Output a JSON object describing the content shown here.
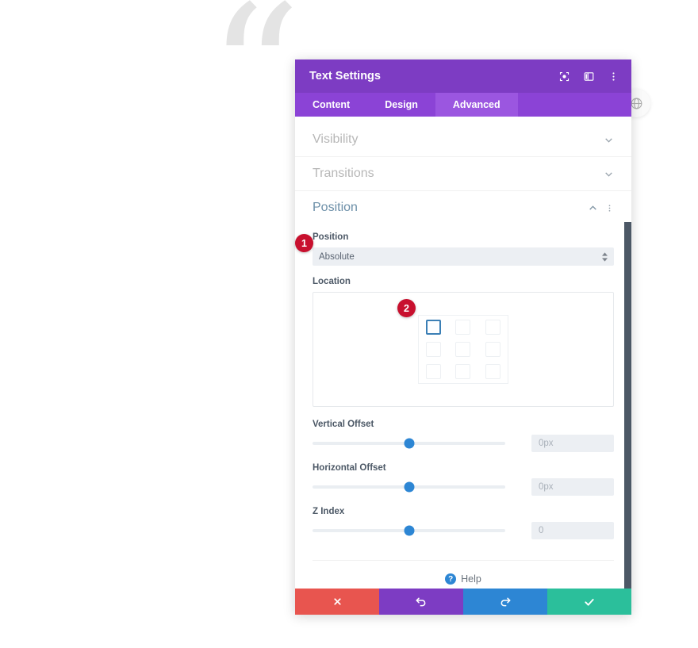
{
  "background": {
    "quote_decoration": "“",
    "side_circle_icon": "globe-icon"
  },
  "modal": {
    "title": "Text Settings",
    "title_icons": [
      {
        "name": "target-icon",
        "label": "Focus"
      },
      {
        "name": "layout-panel-icon",
        "label": "Layout"
      },
      {
        "name": "kebab-menu-icon",
        "label": "More options"
      }
    ],
    "tabs": [
      {
        "label": "Content",
        "active": false
      },
      {
        "label": "Design",
        "active": false
      },
      {
        "label": "Advanced",
        "active": true
      }
    ],
    "sections": [
      {
        "label": "Visibility",
        "open": false,
        "chevron": "chevron-down-icon"
      },
      {
        "label": "Transitions",
        "open": false,
        "chevron": "chevron-down-icon"
      },
      {
        "label": "Position",
        "open": true,
        "chevron": "chevron-up-icon"
      }
    ],
    "position_section": {
      "position_field": {
        "label": "Position",
        "value": "Absolute"
      },
      "location_field": {
        "label": "Location",
        "selected_cell": "top-left",
        "cells": [
          "top-left",
          "top-center",
          "top-right",
          "middle-left",
          "middle-center",
          "middle-right",
          "bottom-left",
          "bottom-center",
          "bottom-right"
        ]
      },
      "vertical_offset": {
        "label": "Vertical Offset",
        "value": "0px",
        "slider_percent": 50
      },
      "horizontal_offset": {
        "label": "Horizontal Offset",
        "value": "0px",
        "slider_percent": 50
      },
      "z_index": {
        "label": "Z Index",
        "value": "0",
        "slider_percent": 50
      }
    },
    "help": {
      "label": "Help",
      "icon": "question-circle-icon"
    },
    "footer_buttons": [
      {
        "name": "discard-button",
        "icon": "close-icon",
        "color": "#e8554f"
      },
      {
        "name": "undo-button",
        "icon": "undo-icon",
        "color": "#7d3cc3"
      },
      {
        "name": "redo-button",
        "icon": "redo-icon",
        "color": "#2d86d4"
      },
      {
        "name": "save-button",
        "icon": "check-icon",
        "color": "#2bbf9b"
      }
    ]
  },
  "annotations": [
    {
      "number": "1",
      "target": "position-select"
    },
    {
      "number": "2",
      "target": "location-grid-top-left"
    }
  ],
  "colors": {
    "titlebar": "#7d3cc3",
    "tabbar": "#8b43d6",
    "tab_active": "#9b56e0",
    "badge": "#c8102e",
    "slider_thumb": "#2d86d4",
    "selected_cell_border": "#3b7fb5",
    "section_open_text": "#6c8fa8",
    "section_closed_text": "#b7b7b7"
  }
}
